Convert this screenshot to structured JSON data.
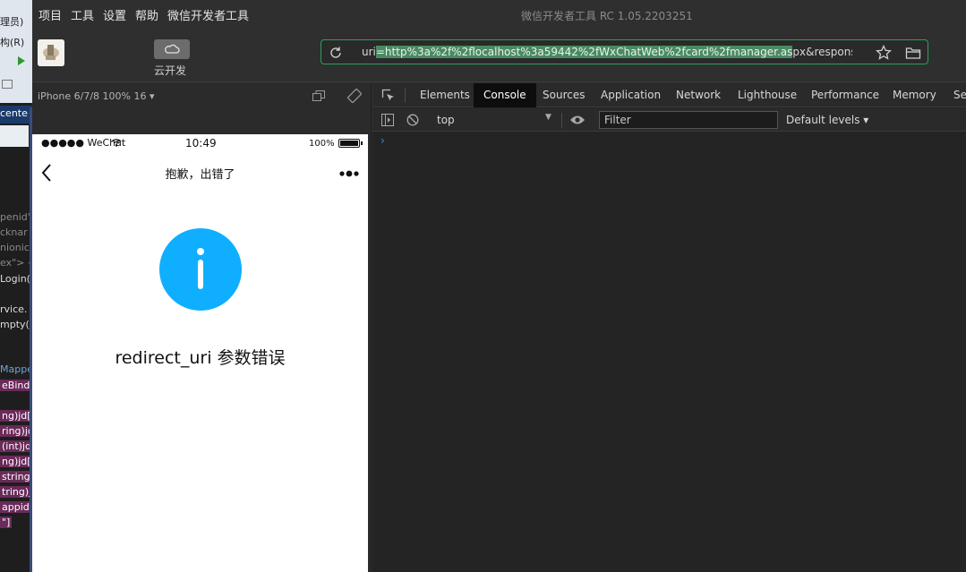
{
  "ide": {
    "top_lines": [
      "理员)",
      "构(R)"
    ],
    "center_tab": "cente",
    "code_lines": [
      {
        "text": "penid'",
        "style": "gray"
      },
      {
        "text": "cknar",
        "style": "gray"
      },
      {
        "text": "nionic",
        "style": "gray"
      },
      {
        "text": "ex\"> <,",
        "style": "gray"
      },
      {
        "text": "Login(",
        "style": ""
      },
      {
        "text": "rvice.",
        "style": ""
      },
      {
        "text": "mpty(j",
        "style": ""
      },
      {
        "text": "Mappe",
        "style": "blue"
      },
      {
        "text": "eBind",
        "style": "hl"
      },
      {
        "text": "ng)jd[\"",
        "style": "hl"
      },
      {
        "text": "ring)jd",
        "style": "hl"
      },
      {
        "text": "(int)jd",
        "style": "hl"
      },
      {
        "text": "ng)jd[\"",
        "style": "hl"
      },
      {
        "text": "string)",
        "style": "hl"
      },
      {
        "text": "tring)jd",
        "style": "hl"
      },
      {
        "text": "appid",
        "style": "hl"
      },
      {
        "text": "\"]",
        "style": "hl"
      }
    ]
  },
  "menu": {
    "items": [
      "项目",
      "工具",
      "设置",
      "帮助",
      "微信开发者工具"
    ],
    "title": "微信开发者工具 RC 1.05.2203251"
  },
  "toolbar": {
    "cloud_label": "云开发",
    "url_prefix": "uri",
    "url_selected": "=http%3a%2f%2flocalhost%3a59442%2fWxChatWeb%2fcard%2fmanager.as",
    "url_rest": "px&response_type=coc"
  },
  "simulator": {
    "device_label": "iPhone 6/7/8 100% 16 ▾",
    "status": {
      "carrier": "●●●●● WeChat",
      "time": "10:49",
      "battery": "100%",
      "battery_level": 1.0
    },
    "nav_title": "抱歉，出错了",
    "error_message": "redirect_uri 参数错误"
  },
  "devtools": {
    "tabs": [
      {
        "label": "Elements",
        "active": false
      },
      {
        "label": "Console",
        "active": true
      },
      {
        "label": "Sources",
        "active": false
      },
      {
        "label": "Application",
        "active": false
      },
      {
        "label": "Network",
        "active": false
      },
      {
        "label": "Lighthouse",
        "active": false
      },
      {
        "label": "Performance",
        "active": false
      },
      {
        "label": "Memory",
        "active": false
      },
      {
        "label": "Se",
        "active": false
      }
    ],
    "context": "top",
    "filter_placeholder": "Filter",
    "levels": "Default levels ▾",
    "prompt": "›"
  },
  "colors": {
    "accent_green": "#27a35a",
    "info_blue": "#10aeff",
    "prompt_blue": "#3d8ee6"
  }
}
